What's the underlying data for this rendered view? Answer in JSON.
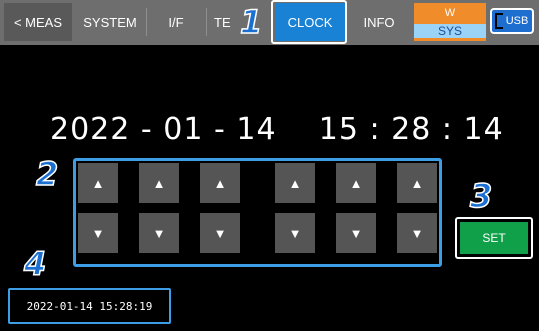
{
  "tabs": {
    "back": "< MEAS",
    "system": "SYSTEM",
    "if": "I/F",
    "te": "TE",
    "clock": "CLOCK",
    "info": "INFO"
  },
  "status": {
    "w": "W",
    "sys": "SYS",
    "usb": "USB"
  },
  "markers": [
    "1",
    "2",
    "3",
    "4"
  ],
  "clock": {
    "date_year": "2022",
    "date_month": "01",
    "date_day": "14",
    "time_hour": "15",
    "time_minute": "28",
    "time_second": "14",
    "date_separator": "-",
    "time_separator": ":"
  },
  "buttons": {
    "up_icon": "▲",
    "down_icon": "▼",
    "set_label": "SET"
  },
  "current_time": "2022-01-14 15:28:19",
  "colors": {
    "active_tab": "#1a82d4",
    "set_button": "#10a04a",
    "highlight_frame": "#3d9ee6",
    "status_orange": "#f08c2a"
  }
}
